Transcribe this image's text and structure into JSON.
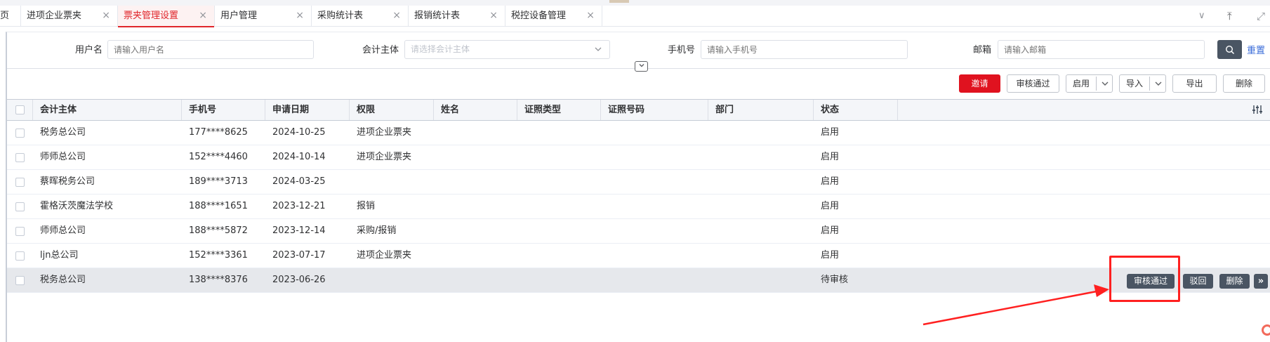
{
  "tabs": [
    {
      "label": "页",
      "close": ""
    },
    {
      "label": "进项企业票夹",
      "close": "×"
    },
    {
      "label": "票夹管理设置",
      "close": "×"
    },
    {
      "label": "用户管理",
      "close": "×"
    },
    {
      "label": "采购统计表",
      "close": "×"
    },
    {
      "label": "报销统计表",
      "close": "×"
    },
    {
      "label": "税控设备管理",
      "close": "×"
    }
  ],
  "tab_tools": {
    "collapse": "∨",
    "upload": "⤒",
    "fullscreen": "⤢"
  },
  "search": {
    "username_label": "用户名",
    "username_placeholder": "请输入用户名",
    "entity_label": "会计主体",
    "entity_placeholder": "请选择会计主体",
    "phone_label": "手机号",
    "phone_placeholder": "请输入手机号",
    "email_label": "邮箱",
    "email_placeholder": "请输入邮箱",
    "reset_label": "重置"
  },
  "toolbar": {
    "invite": "邀请",
    "approve": "审核通过",
    "enable": "启用",
    "import": "导入",
    "export": "导出",
    "delete": "删除"
  },
  "columns": [
    "会计主体",
    "手机号",
    "申请日期",
    "权限",
    "姓名",
    "证照类型",
    "证照号码",
    "部门",
    "状态"
  ],
  "rows": [
    {
      "entity": "税务总公司",
      "phone": "177****8625",
      "date": "2024-10-25",
      "perm": "进项企业票夹",
      "name": "",
      "id_type": "",
      "id_no": "",
      "dept": "",
      "status": "启用"
    },
    {
      "entity": "师师总公司",
      "phone": "152****4460",
      "date": "2024-10-14",
      "perm": "进项企业票夹",
      "name": "",
      "id_type": "",
      "id_no": "",
      "dept": "",
      "status": "启用"
    },
    {
      "entity": "蔡晖税务公司",
      "phone": "189****3713",
      "date": "2024-03-25",
      "perm": "",
      "name": "",
      "id_type": "",
      "id_no": "",
      "dept": "",
      "status": "启用"
    },
    {
      "entity": "霍格沃茨魔法学校",
      "phone": "188****1651",
      "date": "2023-12-21",
      "perm": "报销",
      "name": "",
      "id_type": "",
      "id_no": "",
      "dept": "",
      "status": "启用"
    },
    {
      "entity": "师师总公司",
      "phone": "188****5872",
      "date": "2023-12-14",
      "perm": "采购/报销",
      "name": "",
      "id_type": "",
      "id_no": "",
      "dept": "",
      "status": "启用"
    },
    {
      "entity": "ljn总公司",
      "phone": "152****3361",
      "date": "2023-07-17",
      "perm": "进项企业票夹",
      "name": "",
      "id_type": "",
      "id_no": "",
      "dept": "",
      "status": "启用"
    },
    {
      "entity": "税务总公司",
      "phone": "138****8376",
      "date": "2023-06-26",
      "perm": "",
      "name": "",
      "id_type": "",
      "id_no": "",
      "dept": "",
      "status": "待审核"
    }
  ],
  "row_actions": {
    "approve": "审核通过",
    "reject": "驳回",
    "delete": "删除",
    "more": "»"
  },
  "colors": {
    "primary_red": "#e0121f",
    "dark_button": "#4a5563",
    "annotation_red": "#ff2020",
    "link_blue": "#3a6cd9"
  }
}
